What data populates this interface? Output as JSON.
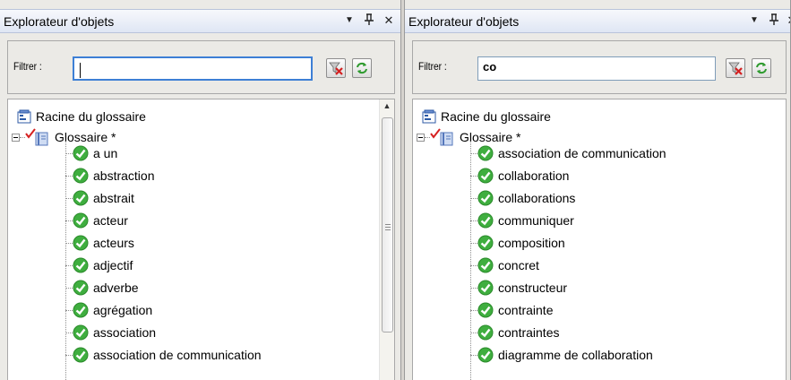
{
  "left_panel": {
    "title": "Explorateur d'objets",
    "filter_label": "Filtrer :",
    "filter_value": "",
    "root_label": "Racine du glossaire",
    "glossary_label": "Glossaire *",
    "items": [
      "a un",
      "abstraction",
      "abstrait",
      "acteur",
      "acteurs",
      "adjectif",
      "adverbe",
      "agrégation",
      "association",
      "association de communication"
    ]
  },
  "right_panel": {
    "title": "Explorateur d'objets",
    "filter_label": "Filtrer :",
    "filter_value": "co",
    "root_label": "Racine du glossaire",
    "glossary_label": "Glossaire *",
    "items": [
      "association de communication",
      "collaboration",
      "collaborations",
      "communiquer",
      "composition",
      "concret",
      "constructeur",
      "contrainte",
      "contraintes",
      "diagramme de collaboration"
    ]
  },
  "titlebar_buttons": {
    "dropdown": "▼",
    "pin": "⊥",
    "close": "✕"
  },
  "icons": {
    "root": "glossary-root-icon",
    "glossary": "glossary-book-icon",
    "item": "green-check-icon",
    "clear_filter": "clear-filter-icon",
    "refresh": "refresh-icon"
  },
  "colors": {
    "titlebar_bg": "#dfe6f4",
    "panel_bg": "#ebeae6",
    "check_green": "#3fae3f",
    "focus_border": "#3d7fd5"
  }
}
